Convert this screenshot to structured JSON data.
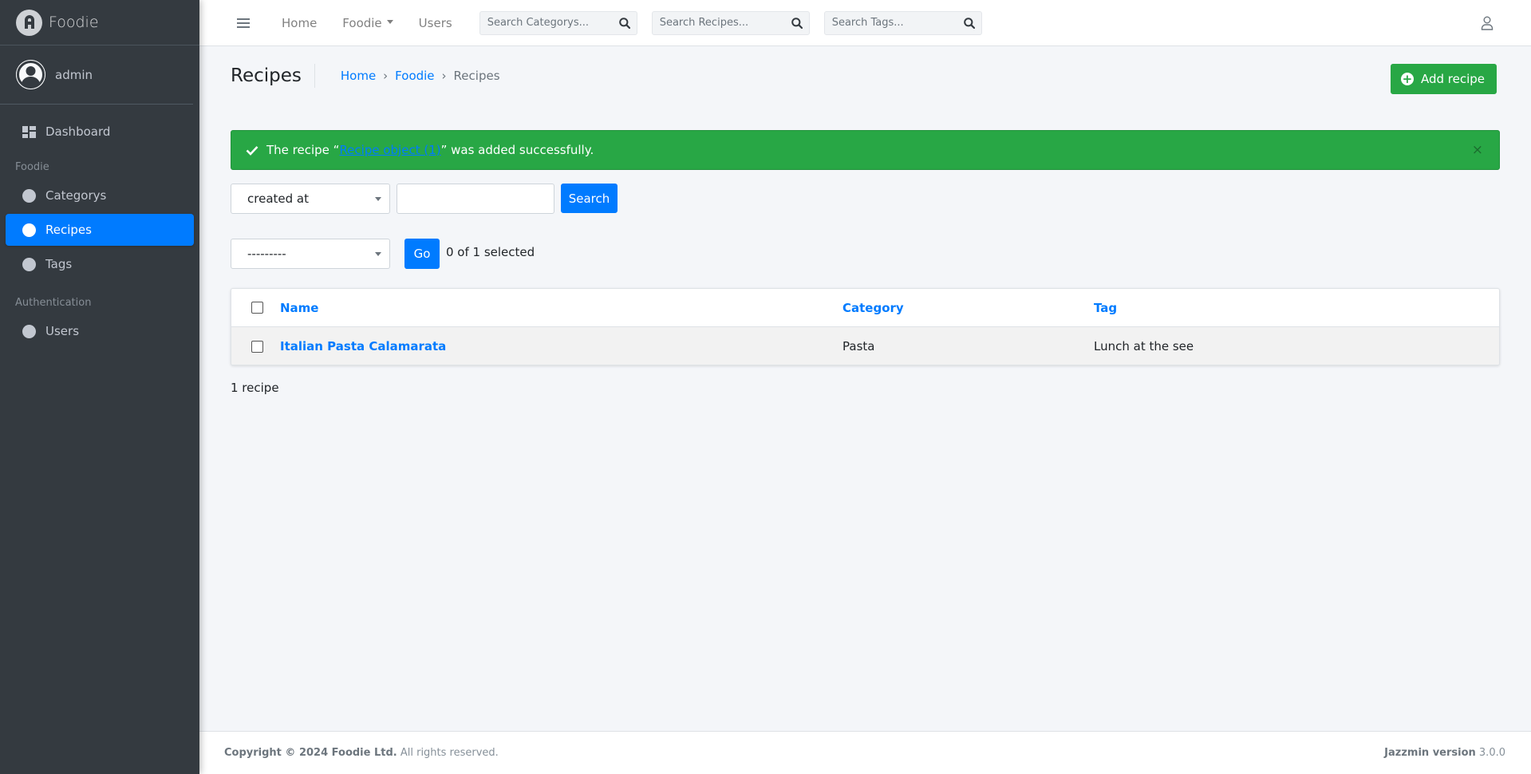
{
  "brand": {
    "name": "Foodie"
  },
  "user": {
    "name": "admin"
  },
  "sidebar": {
    "dashboard": "Dashboard",
    "section_foodie": "Foodie",
    "items": [
      {
        "label": "Categorys",
        "active": false
      },
      {
        "label": "Recipes",
        "active": true
      },
      {
        "label": "Tags",
        "active": false
      }
    ],
    "section_auth": "Authentication",
    "auth_items": [
      {
        "label": "Users"
      }
    ]
  },
  "topbar": {
    "home": "Home",
    "foodie": "Foodie",
    "users": "Users",
    "search_categorys": "Search Categorys...",
    "search_recipes": "Search Recipes...",
    "search_tags": "Search Tags..."
  },
  "header": {
    "title": "Recipes",
    "breadcrumb": [
      "Home",
      "Foodie",
      "Recipes"
    ],
    "breadcrumb_sep": "›",
    "add_button": "Add recipe"
  },
  "alert": {
    "prefix": "The recipe “",
    "link": "Recipe object (1)",
    "suffix": "” was added successfully.",
    "close": "×"
  },
  "search": {
    "field_select": "created at",
    "button": "Search"
  },
  "actions": {
    "select": "---------",
    "go": "Go",
    "selected": "0 of 1 selected"
  },
  "table": {
    "headers": [
      "Name",
      "Category",
      "Tag"
    ],
    "rows": [
      {
        "name": "Italian Pasta Calamarata",
        "category": "Pasta",
        "tag": "Lunch at the see"
      }
    ]
  },
  "result_count": "1 recipe",
  "footer": {
    "copyright_bold": "Copyright © 2024 Foodie Ltd.",
    "copyright_rest": " All rights reserved.",
    "version_label": "Jazzmin version",
    "version": " 3.0.0"
  },
  "colors": {
    "sidebar_bg": "#343a40",
    "primary": "#007bff",
    "success": "#28a745"
  }
}
